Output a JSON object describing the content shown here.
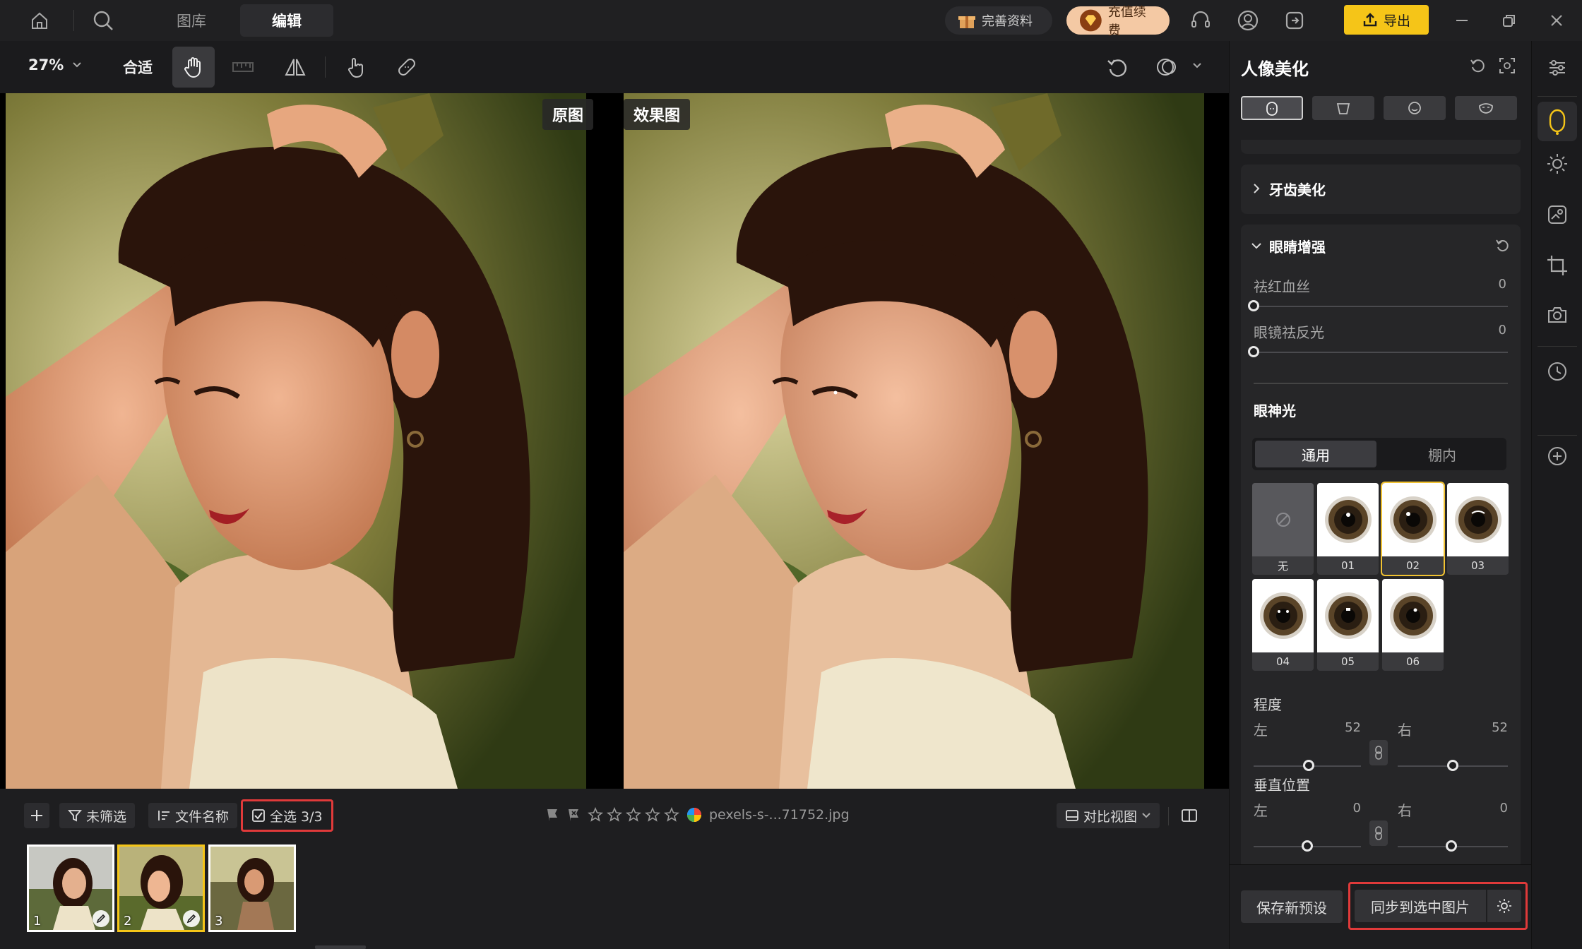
{
  "top": {
    "tab_library": "图库",
    "tab_edit": "编辑",
    "complete_profile": "完善资料",
    "recharge": "充值续费",
    "export": "导出"
  },
  "toolbar": {
    "zoom": "27%",
    "fit": "合适"
  },
  "canvas": {
    "label_original": "原图",
    "label_effect": "效果图"
  },
  "bottom": {
    "filter": "未筛选",
    "sort": "文件名称",
    "select_all": "全选 3/3",
    "filename": "pexels-s-...71752.jpg",
    "compare_view": "对比视图",
    "thumbnails": [
      "1",
      "2",
      "3"
    ]
  },
  "panel": {
    "title": "人像美化",
    "teeth_section": "牙齿美化",
    "eye_section": "眼睛增强",
    "red_veins_label": "祛红血丝",
    "red_veins_value": "0",
    "glasses_glare_label": "眼镜祛反光",
    "glasses_glare_value": "0",
    "catchlight_title": "眼神光",
    "tab_general": "通用",
    "tab_studio": "棚内",
    "presets": [
      "无",
      "01",
      "02",
      "03",
      "04",
      "05",
      "06"
    ],
    "degree_title": "程度",
    "degree_left_label": "左",
    "degree_left_value": "52",
    "degree_right_label": "右",
    "degree_right_value": "52",
    "vertical_title": "垂直位置",
    "vertical_left_label": "左",
    "vertical_left_value": "0",
    "vertical_right_label": "右",
    "vertical_right_value": "0",
    "save_preset": "保存新预设",
    "sync_selected": "同步到选中图片"
  },
  "colors": {
    "accent": "#f5c518",
    "highlight_box": "#e03a3a"
  }
}
